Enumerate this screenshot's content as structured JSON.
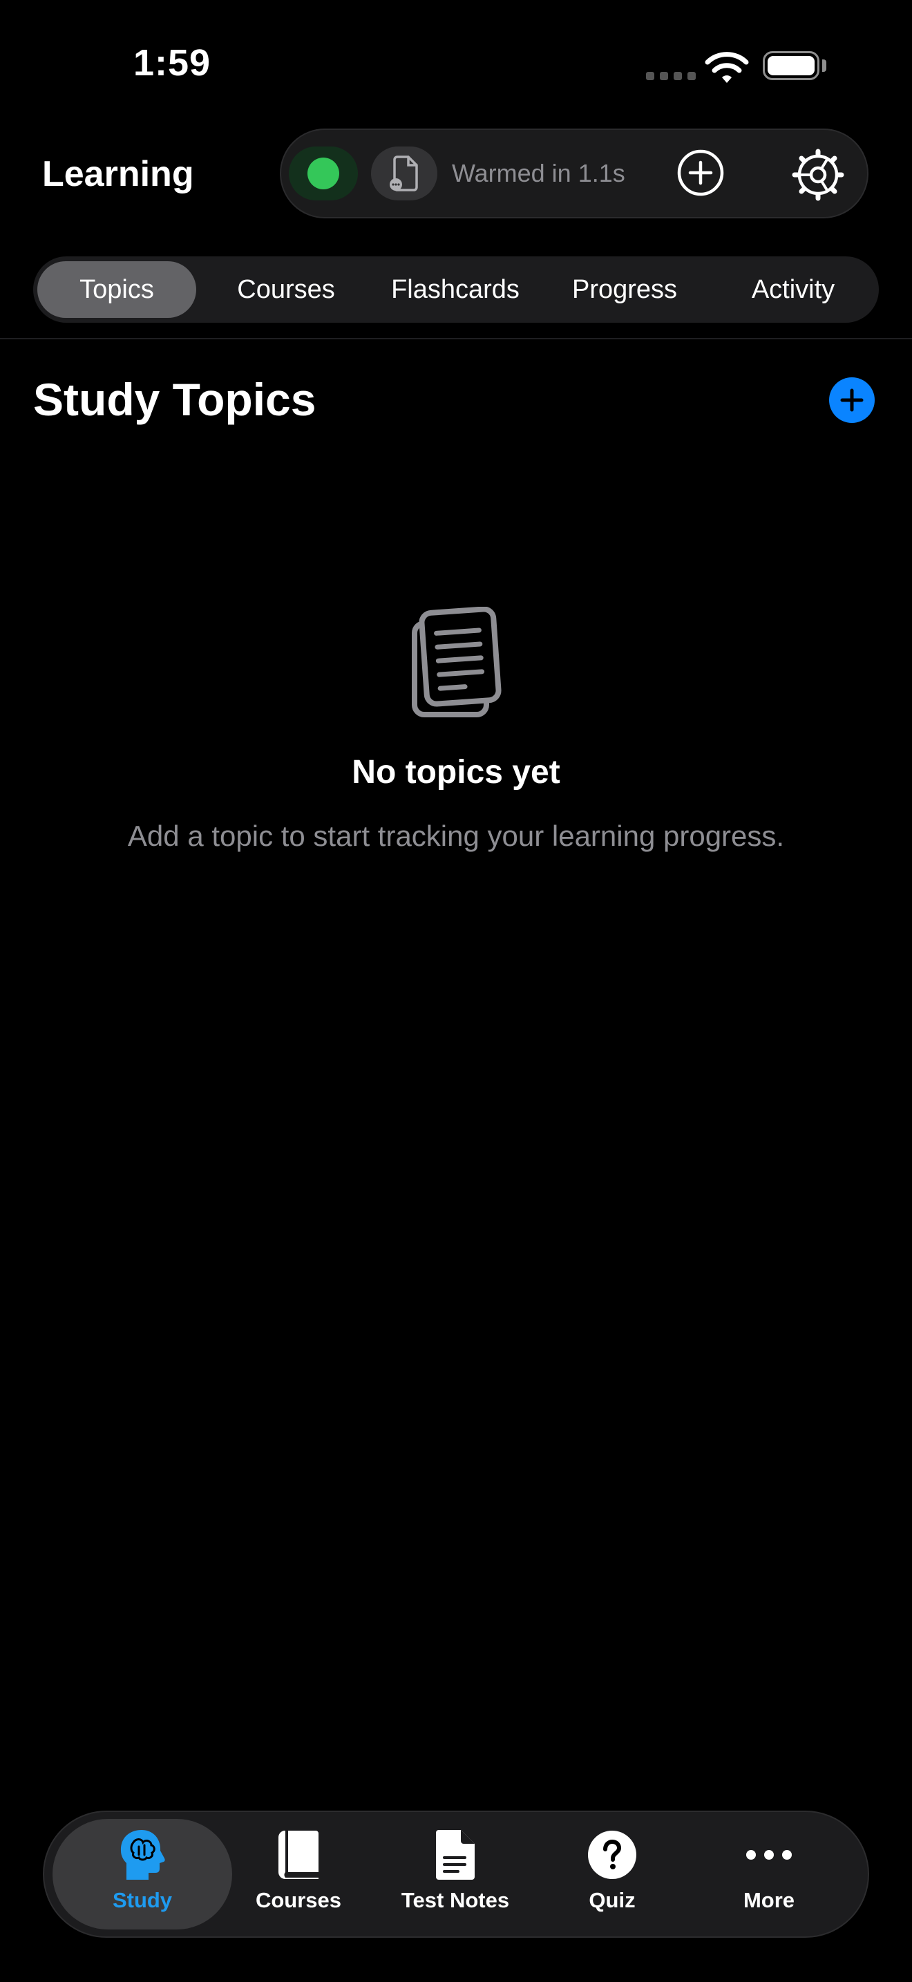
{
  "status_bar": {
    "time": "1:59"
  },
  "header": {
    "title": "Learning",
    "status_text": "Warmed in 1.1s",
    "icons": {
      "status": "status-dot-icon",
      "document": "document-icon",
      "add": "plus-circle-icon",
      "settings": "gear-icon"
    }
  },
  "segments": [
    {
      "label": "Topics",
      "active": true
    },
    {
      "label": "Courses",
      "active": false
    },
    {
      "label": "Flashcards",
      "active": false
    },
    {
      "label": "Progress",
      "active": false
    },
    {
      "label": "Activity",
      "active": false
    }
  ],
  "main": {
    "title": "Study Topics",
    "empty_state": {
      "icon": "documents-icon",
      "title": "No topics yet",
      "subtitle": "Add a topic to start tracking your learning progress."
    }
  },
  "tabbar": {
    "items": [
      {
        "label": "Study",
        "icon": "brain-head-icon",
        "active": true
      },
      {
        "label": "Courses",
        "icon": "book-icon",
        "active": false
      },
      {
        "label": "Test Notes",
        "icon": "note-icon",
        "active": false
      },
      {
        "label": "Quiz",
        "icon": "question-icon",
        "active": false
      },
      {
        "label": "More",
        "icon": "ellipsis-icon",
        "active": false
      }
    ]
  },
  "colors": {
    "accent": "#0a84ff",
    "active_tab": "#1e9bf0",
    "status_green": "#34c759",
    "background": "#000000"
  }
}
